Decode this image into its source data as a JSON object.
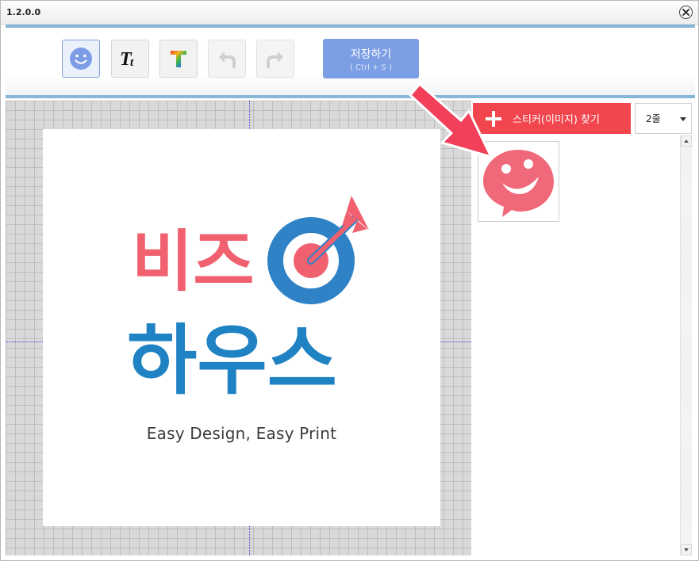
{
  "window": {
    "title": "1.2.0.0"
  },
  "toolbar": {
    "buttons": [
      {
        "name": "sticker",
        "icon": "smiley-icon",
        "state": "active"
      },
      {
        "name": "text",
        "icon": "text-tt-icon",
        "state": "normal"
      },
      {
        "name": "color-text",
        "icon": "rainbow-t-icon",
        "state": "normal"
      },
      {
        "name": "undo",
        "icon": "undo-icon",
        "state": "disabled"
      },
      {
        "name": "redo",
        "icon": "redo-icon",
        "state": "disabled"
      }
    ],
    "save": {
      "label": "저장하기",
      "shortcut": "( Ctrl + S )"
    }
  },
  "canvas": {
    "logo": {
      "line1": "비즈",
      "line2": "하우스",
      "tagline": "Easy Design, Easy Print",
      "colors": {
        "pink": "#f0606f",
        "blue": "#1f82c3"
      }
    }
  },
  "panel": {
    "find_sticker_label": "스티커(이미지) 찾기",
    "rows_select": {
      "value": "2줄"
    },
    "stickers": [
      {
        "name": "pink-smiley-speech-bubble",
        "color": "#f0697a"
      }
    ]
  },
  "colors": {
    "accent_red": "#f1464d",
    "save_blue": "#7c9ee4",
    "toolbar_line": "#86b7d6",
    "annotation_arrow": "#f23f5a"
  }
}
